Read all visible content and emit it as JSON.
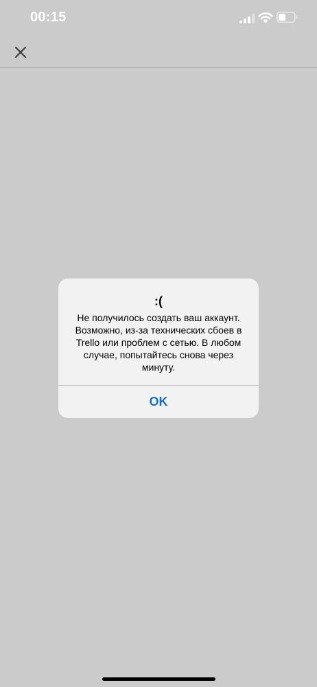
{
  "status_bar": {
    "time": "00:15",
    "icons": [
      "signal-icon",
      "wifi-icon",
      "battery-icon"
    ]
  },
  "nav": {
    "close_icon": "close-icon"
  },
  "alert": {
    "title": ":(",
    "message": "Не получилось создать ваш аккаунт. Возможно, из-за технических сбоев в Trello или проблем с сетью. В любом случае, попытайтесь снова через минуту.",
    "ok_label": "OK"
  },
  "colors": {
    "background": "#cbcbcb",
    "alert_background": "#f2f2f2",
    "accent": "#1a6fb3"
  }
}
